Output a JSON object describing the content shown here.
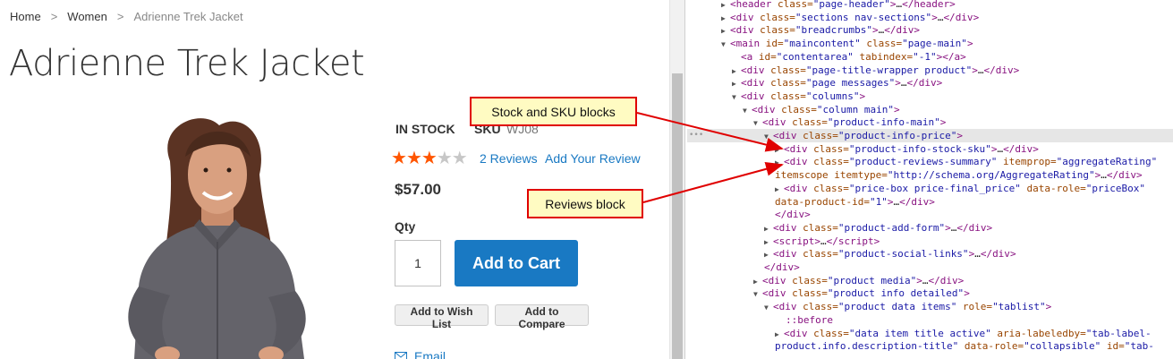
{
  "store": {
    "breadcrumbs": [
      "Home",
      "Women",
      "Adrienne Trek Jacket"
    ],
    "breadcrumb_separator": ">",
    "title": "Adrienne Trek Jacket",
    "stock": "IN STOCK",
    "sku_label": "SKU",
    "sku_value": "WJ08",
    "rating": {
      "value": 3,
      "max": 5
    },
    "reviews_link": "2 Reviews",
    "add_review_link": "Add Your Review",
    "price": "$57.00",
    "qty_label": "Qty",
    "qty_value": "1",
    "add_to_cart": "Add to Cart",
    "wishlist": "Add to Wish List",
    "compare": "Add to Compare",
    "email": "Email",
    "colors": {
      "link": "#1979c3",
      "primary_button": "#1979c3",
      "star": "#ff5501"
    }
  },
  "annotations": {
    "stock_callout": "Stock and SKU blocks",
    "reviews_callout": "Reviews block",
    "colors": {
      "border": "#e00000",
      "fill": "#fffbc2",
      "arrow": "#e00000"
    }
  },
  "devtools": {
    "lines": [
      {
        "indent": 3,
        "tri": "right",
        "parts": [
          [
            "p",
            "<"
          ],
          [
            "t",
            "header"
          ],
          [
            "a",
            " class="
          ],
          [
            "v",
            "\"page-header\""
          ],
          [
            "p",
            ">"
          ],
          [
            "d",
            "…"
          ],
          [
            "p",
            "</"
          ],
          [
            "t",
            "header"
          ],
          [
            "p",
            ">"
          ]
        ]
      },
      {
        "indent": 3,
        "tri": "right",
        "parts": [
          [
            "p",
            "<"
          ],
          [
            "t",
            "div"
          ],
          [
            "a",
            " class="
          ],
          [
            "v",
            "\"sections nav-sections\""
          ],
          [
            "p",
            ">"
          ],
          [
            "d",
            "…"
          ],
          [
            "p",
            "</"
          ],
          [
            "t",
            "div"
          ],
          [
            "p",
            ">"
          ]
        ]
      },
      {
        "indent": 3,
        "tri": "right",
        "parts": [
          [
            "p",
            "<"
          ],
          [
            "t",
            "div"
          ],
          [
            "a",
            " class="
          ],
          [
            "v",
            "\"breadcrumbs\""
          ],
          [
            "p",
            ">"
          ],
          [
            "d",
            "…"
          ],
          [
            "p",
            "</"
          ],
          [
            "t",
            "div"
          ],
          [
            "p",
            ">"
          ]
        ]
      },
      {
        "indent": 3,
        "tri": "down",
        "parts": [
          [
            "p",
            "<"
          ],
          [
            "t",
            "main"
          ],
          [
            "a",
            " id="
          ],
          [
            "v",
            "\"maincontent\""
          ],
          [
            "a",
            " class="
          ],
          [
            "v",
            "\"page-main\""
          ],
          [
            "p",
            ">"
          ]
        ]
      },
      {
        "indent": 4,
        "tri": "",
        "parts": [
          [
            "p",
            "<"
          ],
          [
            "t",
            "a"
          ],
          [
            "a",
            " id="
          ],
          [
            "v",
            "\"contentarea\""
          ],
          [
            "a",
            " tabindex="
          ],
          [
            "v",
            "\"-1\""
          ],
          [
            "p",
            ">"
          ],
          [
            "p",
            "</"
          ],
          [
            "t",
            "a"
          ],
          [
            "p",
            ">"
          ]
        ]
      },
      {
        "indent": 4,
        "tri": "right",
        "parts": [
          [
            "p",
            "<"
          ],
          [
            "t",
            "div"
          ],
          [
            "a",
            " class="
          ],
          [
            "v",
            "\"page-title-wrapper product\""
          ],
          [
            "p",
            ">"
          ],
          [
            "d",
            "…"
          ],
          [
            "p",
            "</"
          ],
          [
            "t",
            "div"
          ],
          [
            "p",
            ">"
          ]
        ]
      },
      {
        "indent": 4,
        "tri": "right",
        "parts": [
          [
            "p",
            "<"
          ],
          [
            "t",
            "div"
          ],
          [
            "a",
            " class="
          ],
          [
            "v",
            "\"page messages\""
          ],
          [
            "p",
            ">"
          ],
          [
            "d",
            "…"
          ],
          [
            "p",
            "</"
          ],
          [
            "t",
            "div"
          ],
          [
            "p",
            ">"
          ]
        ]
      },
      {
        "indent": 4,
        "tri": "down",
        "parts": [
          [
            "p",
            "<"
          ],
          [
            "t",
            "div"
          ],
          [
            "a",
            " class="
          ],
          [
            "v",
            "\"columns\""
          ],
          [
            "p",
            ">"
          ]
        ]
      },
      {
        "indent": 5,
        "tri": "down",
        "parts": [
          [
            "p",
            "<"
          ],
          [
            "t",
            "div"
          ],
          [
            "a",
            " class="
          ],
          [
            "v",
            "\"column main\""
          ],
          [
            "p",
            ">"
          ]
        ]
      },
      {
        "indent": 6,
        "tri": "down",
        "parts": [
          [
            "p",
            "<"
          ],
          [
            "t",
            "div"
          ],
          [
            "a",
            " class="
          ],
          [
            "v",
            "\"product-info-main\""
          ],
          [
            "p",
            ">"
          ]
        ]
      },
      {
        "indent": 7,
        "tri": "down",
        "sel": true,
        "parts": [
          [
            "p",
            "<"
          ],
          [
            "t",
            "div"
          ],
          [
            "a",
            " class="
          ],
          [
            "v",
            "\"product-info-price\""
          ],
          [
            "p",
            ">"
          ]
        ]
      },
      {
        "indent": 8,
        "tri": "right",
        "parts": [
          [
            "p",
            "<"
          ],
          [
            "t",
            "div"
          ],
          [
            "a",
            " class="
          ],
          [
            "v",
            "\"product-info-stock-sku\""
          ],
          [
            "p",
            ">"
          ],
          [
            "d",
            "…"
          ],
          [
            "p",
            "</"
          ],
          [
            "t",
            "div"
          ],
          [
            "p",
            ">"
          ]
        ]
      },
      {
        "indent": 8,
        "tri": "right",
        "parts": [
          [
            "p",
            "<"
          ],
          [
            "t",
            "div"
          ],
          [
            "a",
            " class="
          ],
          [
            "v",
            "\"product-reviews-summary\""
          ],
          [
            "a",
            " itemprop="
          ],
          [
            "v",
            "\"aggregateRating\""
          ]
        ]
      },
      {
        "indent": 7,
        "tri": "",
        "wrap": true,
        "parts": [
          [
            "a",
            "itemscope itemtype="
          ],
          [
            "v",
            "\"http://schema.org/AggregateRating\""
          ],
          [
            "p",
            ">"
          ],
          [
            "d",
            "…"
          ],
          [
            "p",
            "</"
          ],
          [
            "t",
            "div"
          ],
          [
            "p",
            ">"
          ]
        ]
      },
      {
        "indent": 8,
        "tri": "right",
        "parts": [
          [
            "p",
            "<"
          ],
          [
            "t",
            "div"
          ],
          [
            "a",
            " class="
          ],
          [
            "v",
            "\"price-box price-final_price\""
          ],
          [
            "a",
            " data-role="
          ],
          [
            "v",
            "\"priceBox\""
          ]
        ]
      },
      {
        "indent": 7,
        "tri": "",
        "wrap": true,
        "parts": [
          [
            "a",
            "data-product-id="
          ],
          [
            "v",
            "\"1\""
          ],
          [
            "p",
            ">"
          ],
          [
            "d",
            "…"
          ],
          [
            "p",
            "</"
          ],
          [
            "t",
            "div"
          ],
          [
            "p",
            ">"
          ]
        ]
      },
      {
        "indent": 7,
        "tri": "",
        "wrap": true,
        "parts": [
          [
            "p",
            "</"
          ],
          [
            "t",
            "div"
          ],
          [
            "p",
            ">"
          ]
        ]
      },
      {
        "indent": 7,
        "tri": "right",
        "parts": [
          [
            "p",
            "<"
          ],
          [
            "t",
            "div"
          ],
          [
            "a",
            " class="
          ],
          [
            "v",
            "\"product-add-form\""
          ],
          [
            "p",
            ">"
          ],
          [
            "d",
            "…"
          ],
          [
            "p",
            "</"
          ],
          [
            "t",
            "div"
          ],
          [
            "p",
            ">"
          ]
        ]
      },
      {
        "indent": 7,
        "tri": "right",
        "parts": [
          [
            "p",
            "<"
          ],
          [
            "t",
            "script"
          ],
          [
            "p",
            ">"
          ],
          [
            "d",
            "…"
          ],
          [
            "p",
            "</"
          ],
          [
            "t",
            "script"
          ],
          [
            "p",
            ">"
          ]
        ]
      },
      {
        "indent": 7,
        "tri": "right",
        "parts": [
          [
            "p",
            "<"
          ],
          [
            "t",
            "div"
          ],
          [
            "a",
            " class="
          ],
          [
            "v",
            "\"product-social-links\""
          ],
          [
            "p",
            ">"
          ],
          [
            "d",
            "…"
          ],
          [
            "p",
            "</"
          ],
          [
            "t",
            "div"
          ],
          [
            "p",
            ">"
          ]
        ]
      },
      {
        "indent": 6,
        "tri": "",
        "wrap": true,
        "parts": [
          [
            "p",
            "</"
          ],
          [
            "t",
            "div"
          ],
          [
            "p",
            ">"
          ]
        ]
      },
      {
        "indent": 6,
        "tri": "right",
        "parts": [
          [
            "p",
            "<"
          ],
          [
            "t",
            "div"
          ],
          [
            "a",
            " class="
          ],
          [
            "v",
            "\"product media\""
          ],
          [
            "p",
            ">"
          ],
          [
            "d",
            "…"
          ],
          [
            "p",
            "</"
          ],
          [
            "t",
            "div"
          ],
          [
            "p",
            ">"
          ]
        ]
      },
      {
        "indent": 6,
        "tri": "down",
        "parts": [
          [
            "p",
            "<"
          ],
          [
            "t",
            "div"
          ],
          [
            "a",
            " class="
          ],
          [
            "v",
            "\"product info detailed\""
          ],
          [
            "p",
            ">"
          ]
        ]
      },
      {
        "indent": 7,
        "tri": "down",
        "parts": [
          [
            "p",
            "<"
          ],
          [
            "t",
            "div"
          ],
          [
            "a",
            " class="
          ],
          [
            "v",
            "\"product data items\""
          ],
          [
            "a",
            " role="
          ],
          [
            "v",
            "\"tablist\""
          ],
          [
            "p",
            ">"
          ]
        ]
      },
      {
        "indent": 8,
        "tri": "",
        "wrap": true,
        "parts": [
          [
            "s",
            "::before"
          ]
        ]
      },
      {
        "indent": 8,
        "tri": "right",
        "parts": [
          [
            "p",
            "<"
          ],
          [
            "t",
            "div"
          ],
          [
            "a",
            " class="
          ],
          [
            "v",
            "\"data item title active\""
          ],
          [
            "a",
            " aria-labeledby="
          ],
          [
            "v",
            "\"tab-label-"
          ]
        ]
      },
      {
        "indent": 7,
        "tri": "",
        "wrap": true,
        "parts": [
          [
            "v",
            "product.info.description-title\""
          ],
          [
            "a",
            " data-role="
          ],
          [
            "v",
            "\"collapsible\""
          ],
          [
            "a",
            " id="
          ],
          [
            "v",
            "\"tab-"
          ]
        ]
      }
    ]
  }
}
